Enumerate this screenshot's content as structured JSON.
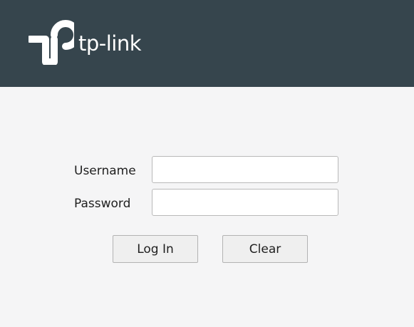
{
  "header": {
    "logo_text": "tp-link",
    "logo_icon": "tp-link-logo-icon",
    "background_color": "#36454d"
  },
  "login_form": {
    "username_label": "Username",
    "username_value": "",
    "password_label": "Password",
    "password_value": "",
    "login_button_label": "Log In",
    "clear_button_label": "Clear"
  }
}
